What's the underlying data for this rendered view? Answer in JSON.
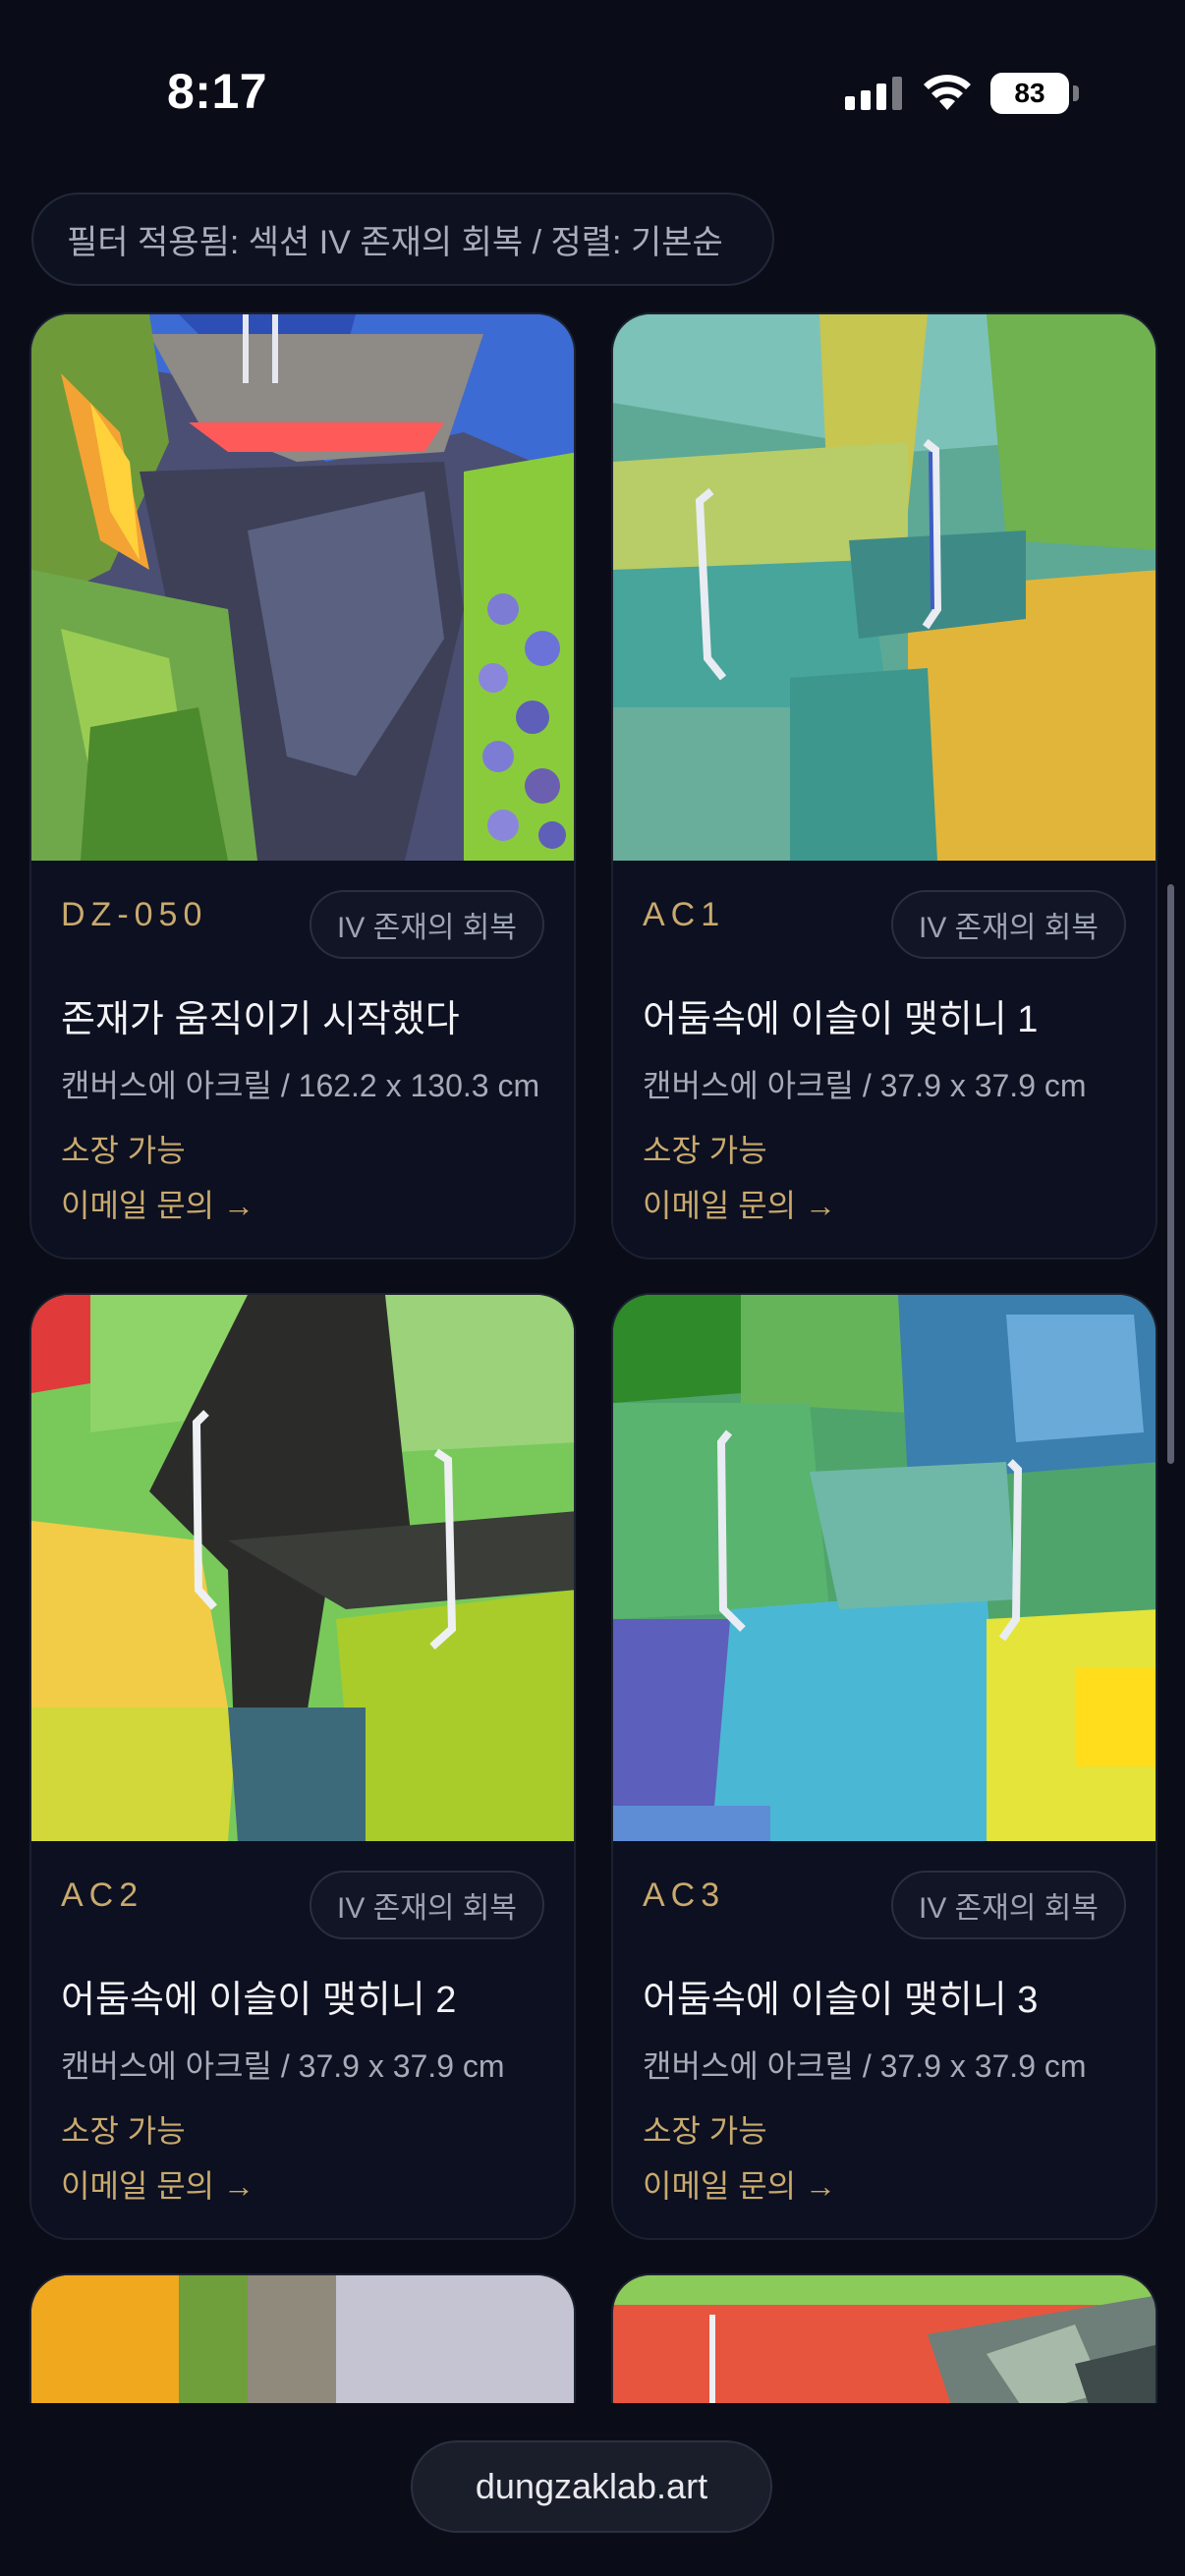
{
  "status_bar": {
    "time": "8:17",
    "battery_level": "83",
    "icons": [
      "signal-icon",
      "wifi-icon",
      "battery-icon"
    ]
  },
  "filter": {
    "label": "필터 적용됨: 섹션 IV 존재의 회복 / 정렬: 기본순"
  },
  "artworks": [
    {
      "code": "DZ-050",
      "section_tag": "IV 존재의 회복",
      "title": "존재가 움직이기 시작했다",
      "medium": "캔버스에 아크릴 / 162.2 x 130.3 cm",
      "status": "소장 가능",
      "inquiry": "이메일 문의 →"
    },
    {
      "code": "AC1",
      "section_tag": "IV 존재의 회복",
      "title": "어둠속에 이슬이 맺히니 1",
      "medium": "캔버스에 아크릴 / 37.9 x 37.9 cm",
      "status": "소장 가능",
      "inquiry": "이메일 문의 →"
    },
    {
      "code": "AC2",
      "section_tag": "IV 존재의 회복",
      "title": "어둠속에 이슬이 맺히니 2",
      "medium": "캔버스에 아크릴 / 37.9 x 37.9 cm",
      "status": "소장 가능",
      "inquiry": "이메일 문의 →"
    },
    {
      "code": "AC3",
      "section_tag": "IV 존재의 회복",
      "title": "어둠속에 이슬이 맺히니 3",
      "medium": "캔버스에 아크릴 / 37.9 x 37.9 cm",
      "status": "소장 가능",
      "inquiry": "이메일 문의 →"
    }
  ],
  "address_bar": {
    "url": "dungzaklab.art"
  },
  "colors": {
    "background": "#0a0d18",
    "card": "#0c1020",
    "accent_gold": "#c9a96e"
  }
}
